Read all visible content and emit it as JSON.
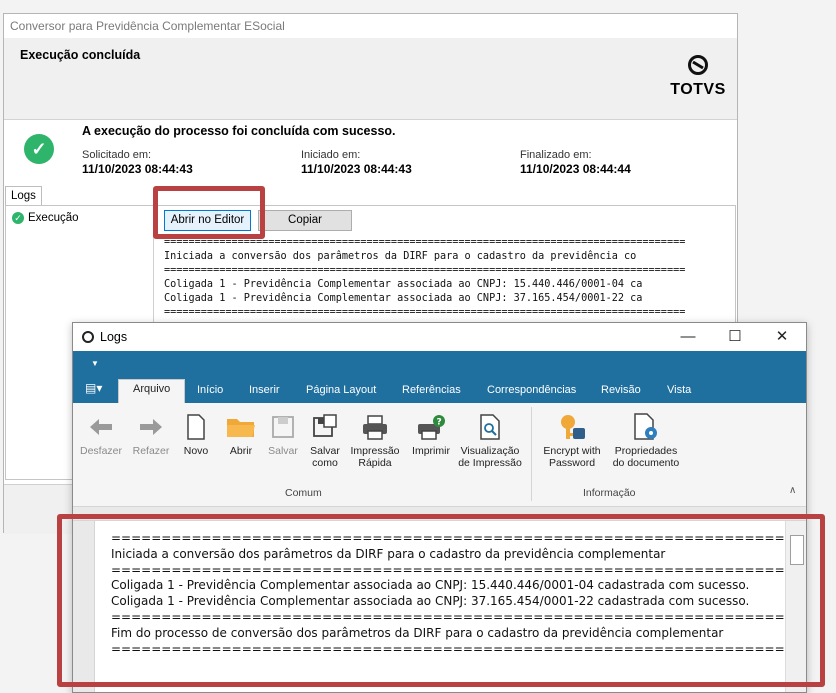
{
  "background_window": {
    "title": "Conversor para Previdência Complementar ESocial",
    "header_title": "Execução concluída",
    "logo_text": "TOTVS",
    "success_message": "A execução do processo foi concluída com sucesso.",
    "timestamps": {
      "solicitado_label": "Solicitado em:",
      "solicitado_value": "11/10/2023 08:44:43",
      "iniciado_label": "Iniciado em:",
      "iniciado_value": "11/10/2023 08:44:43",
      "finalizado_label": "Finalizado em:",
      "finalizado_value": "11/10/2023 08:44:44"
    },
    "logs_tab": "Logs",
    "tree_item": "Execução",
    "buttons": {
      "open_editor": "Abrir no Editor",
      "copy": "Copiar"
    },
    "log_preview": "=====================================================================================\nIniciada a conversão dos parâmetros da DIRF para o cadastro da previdência co\n=====================================================================================\nColigada 1 - Previdência Complementar associada ao CNPJ: 15.440.446/0001-04 ca\nColigada 1 - Previdência Complementar associada ao CNPJ: 37.165.454/0001-22 ca\n====================================================================================="
  },
  "logs_window": {
    "title": "Logs",
    "controls": {
      "minimize": "—",
      "maximize": "☐",
      "close": "✕"
    },
    "file_menu": "▤▾",
    "qat_arrow": "▼",
    "tabs": [
      "Arquivo",
      "Início",
      "Inserir",
      "Página Layout",
      "Referências",
      "Correspondências",
      "Revisão",
      "Vista"
    ],
    "ribbon": {
      "desfazer": "Desfazer",
      "refazer": "Refazer",
      "novo": "Novo",
      "abrir": "Abrir",
      "salvar": "Salvar",
      "salvar_como": "Salvar\ncomo",
      "impressao_rapida": "Impressão\nRápida",
      "imprimir": "Imprimir",
      "visualizacao": "Visualização\nde Impressão",
      "encrypt": "Encrypt with\nPassword",
      "propriedades": "Propriedades\ndo documento",
      "group_comum": "Comum",
      "group_informacao": "Informação"
    },
    "document_text": "================================================================================\nIniciada a conversão dos parâmetros da DIRF para o cadastro da previdência complementar\n================================================================================\nColigada 1 - Previdência Complementar associada ao CNPJ: 15.440.446/0001-04 cadastrada com sucesso.\nColigada 1 - Previdência Complementar associada ao CNPJ: 37.165.454/0001-22 cadastrada com sucesso.\n================================================================================\nFim do processo de conversão dos parâmetros da DIRF para o cadastro da previdência complementar\n================================================================================"
  },
  "colors": {
    "accent": "#1f6f9f",
    "success": "#2eb46b",
    "highlight": "#b94141"
  }
}
